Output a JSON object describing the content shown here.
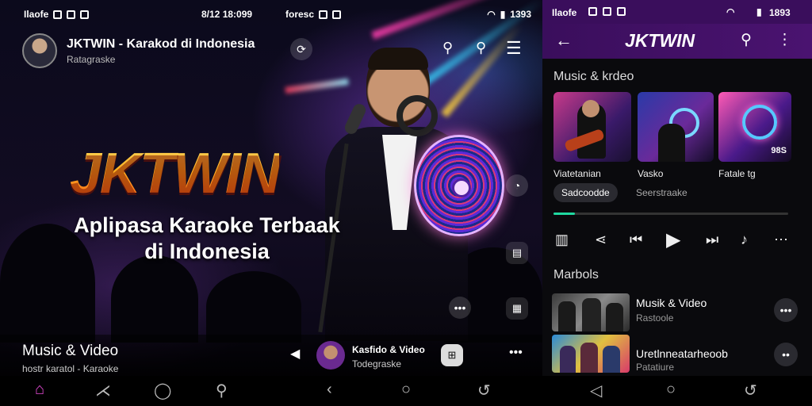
{
  "status_left": {
    "left_text": "Ilaofe",
    "time": "8/12 18:099",
    "right_text": "foresc",
    "battery": "1393"
  },
  "status_right": {
    "left_text": "Ilaofe",
    "battery": "1893"
  },
  "channel": {
    "title": "JKTWIN - Karakod di Indonesia",
    "subtitle": "Ratagraske"
  },
  "hero": {
    "brand": "JKTWIN",
    "tagline_line1": "Aplipasa Karaoke Terbaak",
    "tagline_line2": "di Indonesia"
  },
  "now_playing": {
    "title": "Music & Video",
    "subtitle": "hostr karatol - Karaoke",
    "mini_title": "Kasfido & Video",
    "mini_subtitle": "Todegraske"
  },
  "right": {
    "app_title": "JKTWIN",
    "section_title": "Music & krdeo",
    "thumbs": [
      {
        "label": "Viatetanian"
      },
      {
        "label": "Vasko"
      },
      {
        "label": "Fatale tg",
        "badge": "98S"
      }
    ],
    "chip_active": "Sadcoodde",
    "chip_other": "Seerstraake",
    "progress": 0.09,
    "list_section": "Marbols",
    "list": [
      {
        "title": "Musik & Video",
        "subtitle": "Rastoole"
      },
      {
        "title": "Uretlnneatarheoob",
        "subtitle": "Patatiure"
      }
    ]
  },
  "icons": {
    "back": "arrow-left-icon",
    "search": "search-icon",
    "menu": "hamburger-menu-icon",
    "more": "more-vertical-icon"
  },
  "colors": {
    "accent_purple": "#4a1370",
    "progress_green": "#1fd9a0",
    "home_pink": "#e64bd6"
  }
}
